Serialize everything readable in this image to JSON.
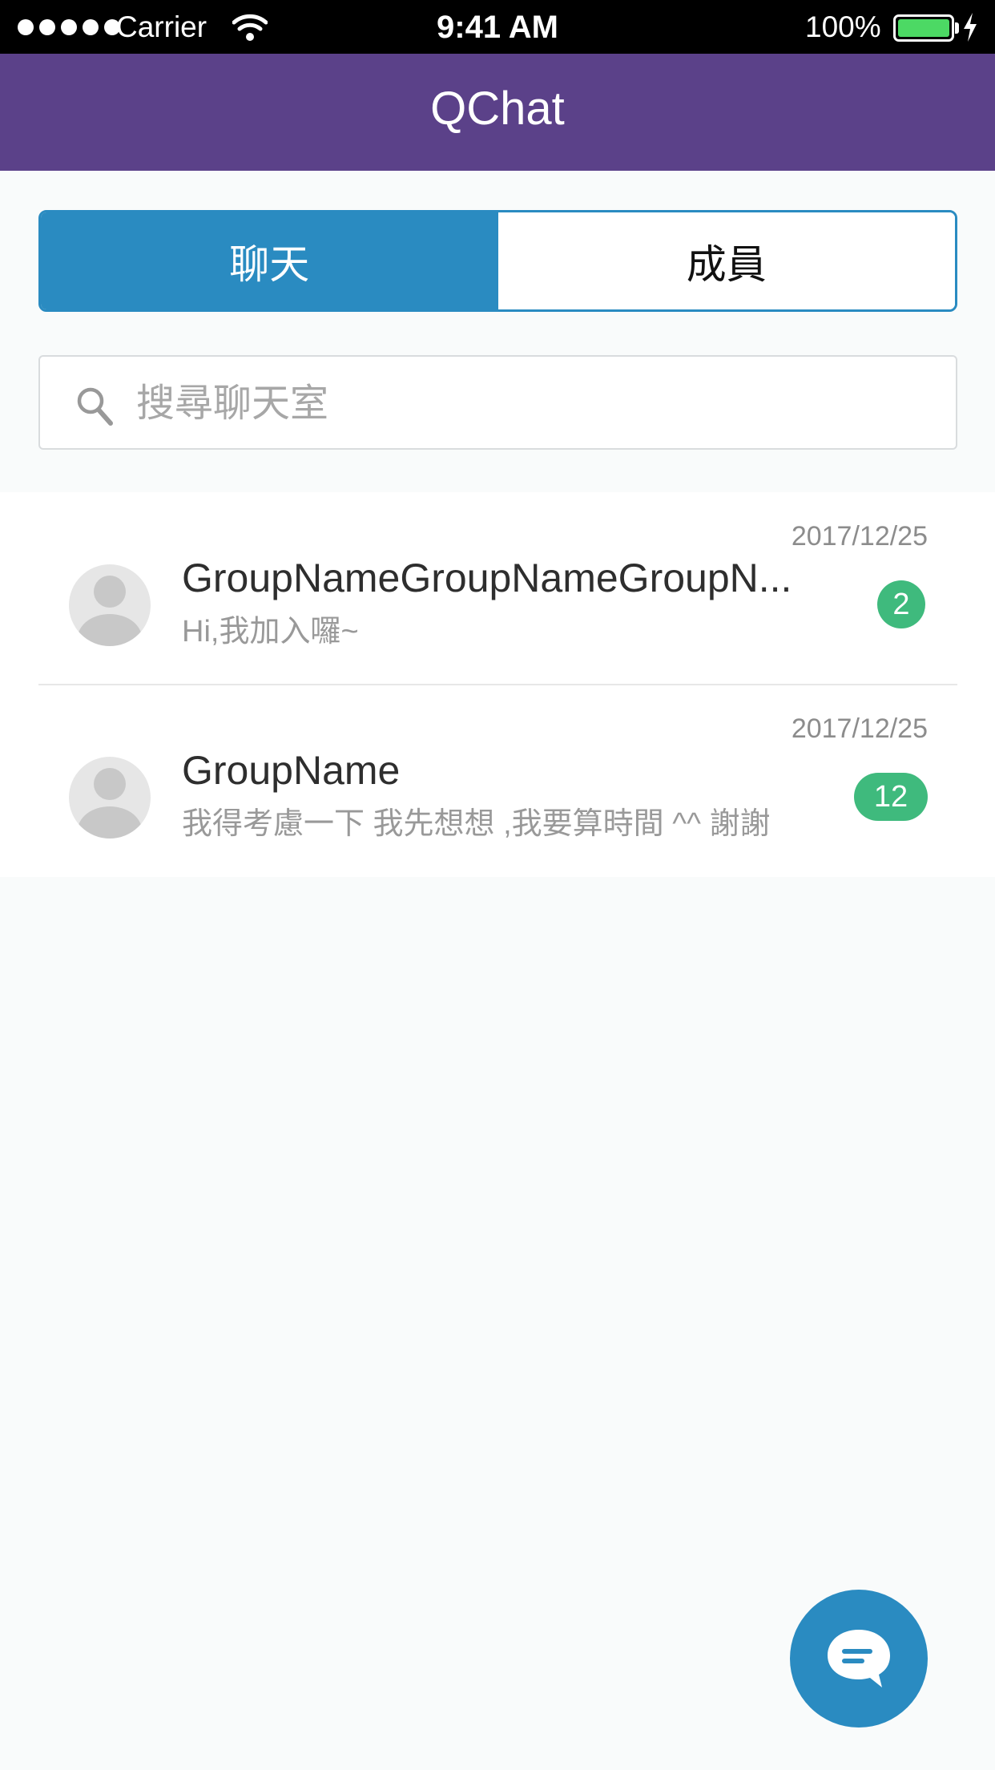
{
  "status_bar": {
    "carrier": "Carrier",
    "time": "9:41 AM",
    "battery": "100%"
  },
  "nav": {
    "title": "QChat"
  },
  "tabs": [
    {
      "label": "聊天",
      "active": true
    },
    {
      "label": "成員",
      "active": false
    }
  ],
  "search": {
    "placeholder": "搜尋聊天室",
    "value": ""
  },
  "chats": [
    {
      "name": "GroupNameGroupNameGroupN...",
      "preview": "Hi,我加入囉~",
      "date": "2017/12/25",
      "unread": "2"
    },
    {
      "name": "GroupName",
      "preview": "我得考慮一下 我先想想 ,我要算時間 ^^ 謝謝",
      "date": "2017/12/25",
      "unread": "12"
    }
  ],
  "colors": {
    "nav": "#5b4189",
    "accent": "#2a8bc1",
    "badge": "#3fba7d"
  },
  "icons": {
    "search": "search-icon",
    "avatar": "avatar-placeholder-icon",
    "fab": "chat-bubble-icon"
  }
}
